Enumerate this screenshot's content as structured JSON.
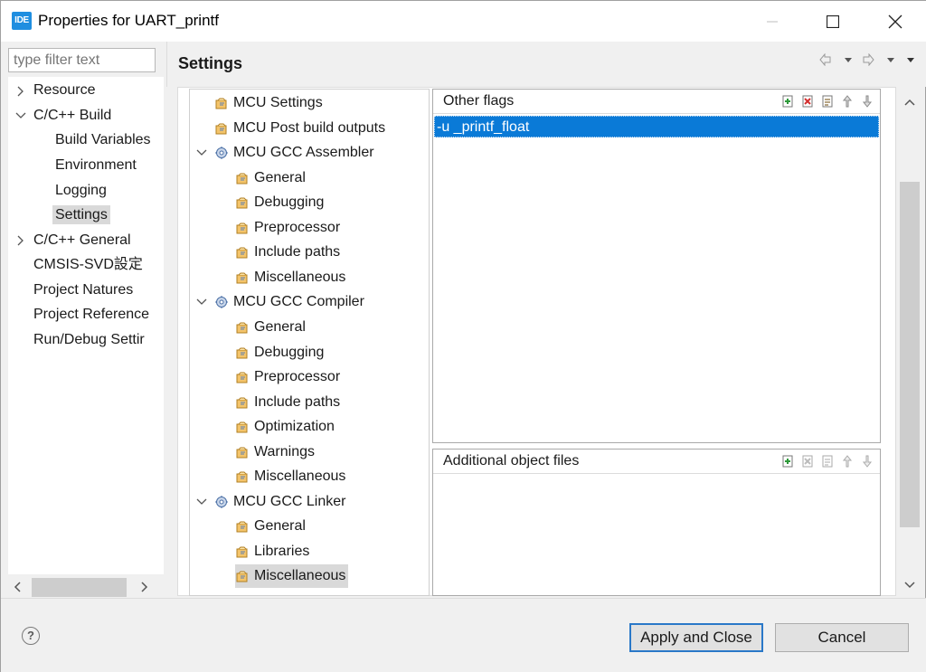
{
  "window": {
    "app_icon_text": "IDE",
    "title": "Properties for UART_printf"
  },
  "filter": {
    "placeholder": "type filter text"
  },
  "nav": {
    "items": [
      {
        "label": "Resource"
      },
      {
        "label": "C/C++ Build"
      },
      {
        "label": "Build Variables"
      },
      {
        "label": "Environment"
      },
      {
        "label": "Logging"
      },
      {
        "label": "Settings"
      },
      {
        "label": "C/C++ General"
      },
      {
        "label": "CMSIS-SVD設定"
      },
      {
        "label": "Project Natures"
      },
      {
        "label": "Project Reference"
      },
      {
        "label": "Run/Debug Settir"
      }
    ],
    "selected": "Settings"
  },
  "header": {
    "title": "Settings"
  },
  "tool_tree": {
    "items": [
      {
        "label": "MCU Settings"
      },
      {
        "label": "MCU Post build outputs"
      },
      {
        "label": "MCU GCC Assembler"
      },
      {
        "label": "General"
      },
      {
        "label": "Debugging"
      },
      {
        "label": "Preprocessor"
      },
      {
        "label": "Include paths"
      },
      {
        "label": "Miscellaneous"
      },
      {
        "label": "MCU GCC Compiler"
      },
      {
        "label": "General"
      },
      {
        "label": "Debugging"
      },
      {
        "label": "Preprocessor"
      },
      {
        "label": "Include paths"
      },
      {
        "label": "Optimization"
      },
      {
        "label": "Warnings"
      },
      {
        "label": "Miscellaneous"
      },
      {
        "label": "MCU GCC Linker"
      },
      {
        "label": "General"
      },
      {
        "label": "Libraries"
      },
      {
        "label": "Miscellaneous"
      }
    ],
    "selected": "Miscellaneous"
  },
  "other_flags": {
    "title": "Other flags",
    "values": [
      "-u _printf_float"
    ]
  },
  "additional_objects": {
    "title": "Additional object files",
    "values": []
  },
  "footer": {
    "help": "?",
    "apply_label": "Apply and Close",
    "cancel_label": "Cancel"
  },
  "colors": {
    "selection_blue": "#0a7ad7",
    "app_icon_blue": "#1f8ee0",
    "default_button_border": "#2a78c8"
  }
}
